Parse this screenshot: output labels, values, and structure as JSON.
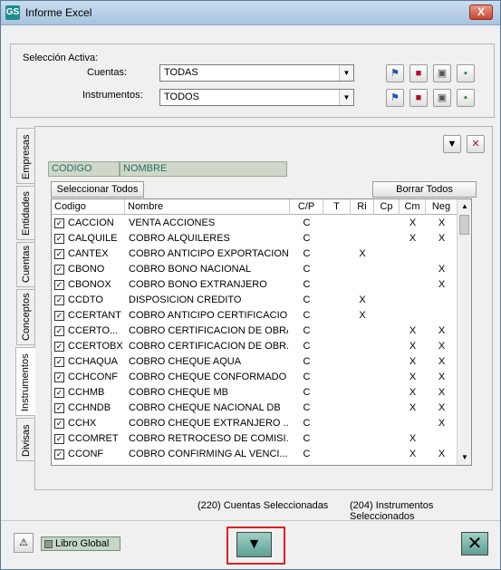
{
  "window": {
    "title": "Informe Excel",
    "app_icon": "GS",
    "close": "X"
  },
  "seleccion": {
    "title": "Selección Activa:",
    "cuentas_label": "Cuentas:",
    "cuentas_value": "TODAS",
    "instrumentos_label": "Instrumentos:",
    "instrumentos_value": "TODOS"
  },
  "tabs": [
    "Empresas",
    "Entidades",
    "Cuentas",
    "Conceptos",
    "Instrumentos",
    "Divisas"
  ],
  "active_tab": "Instrumentos",
  "filter_headers": {
    "codigo": "CODIGO",
    "nombre": "NOMBRE"
  },
  "buttons": {
    "select_all": "Seleccionar Todos",
    "clear_all": "Borrar Todos"
  },
  "columns": [
    "Codigo",
    "Nombre",
    "C/P",
    "T",
    "Ri",
    "Cp",
    "Cm",
    "Neg"
  ],
  "rows": [
    {
      "codigo": "CACCION",
      "nombre": "VENTA ACCIONES",
      "cp": "C",
      "t": "",
      "ri": "",
      "cpx": "",
      "cm": "X",
      "neg": "X"
    },
    {
      "codigo": "CALQUILE",
      "nombre": "COBRO ALQUILERES",
      "cp": "C",
      "t": "",
      "ri": "",
      "cpx": "",
      "cm": "X",
      "neg": "X"
    },
    {
      "codigo": "CANTEX",
      "nombre": "COBRO ANTICIPO EXPORTACION",
      "cp": "C",
      "t": "",
      "ri": "X",
      "cpx": "",
      "cm": "",
      "neg": ""
    },
    {
      "codigo": "CBONO",
      "nombre": "COBRO BONO NACIONAL",
      "cp": "C",
      "t": "",
      "ri": "",
      "cpx": "",
      "cm": "",
      "neg": "X"
    },
    {
      "codigo": "CBONOX",
      "nombre": "COBRO BONO EXTRANJERO",
      "cp": "C",
      "t": "",
      "ri": "",
      "cpx": "",
      "cm": "",
      "neg": "X"
    },
    {
      "codigo": "CCDTO",
      "nombre": "DISPOSICION CREDITO",
      "cp": "C",
      "t": "",
      "ri": "X",
      "cpx": "",
      "cm": "",
      "neg": ""
    },
    {
      "codigo": "CCERTANT",
      "nombre": "COBRO ANTICIPO CERTIFICACION",
      "cp": "C",
      "t": "",
      "ri": "X",
      "cpx": "",
      "cm": "",
      "neg": ""
    },
    {
      "codigo": "CCERTO...",
      "nombre": "COBRO CERTIFICACION DE OBRA",
      "cp": "C",
      "t": "",
      "ri": "",
      "cpx": "",
      "cm": "X",
      "neg": "X"
    },
    {
      "codigo": "CCERTOBX",
      "nombre": "COBRO CERTIFICACION DE OBR...",
      "cp": "C",
      "t": "",
      "ri": "",
      "cpx": "",
      "cm": "X",
      "neg": "X"
    },
    {
      "codigo": "CCHAQUA",
      "nombre": "COBRO CHEQUE AQUA",
      "cp": "C",
      "t": "",
      "ri": "",
      "cpx": "",
      "cm": "X",
      "neg": "X"
    },
    {
      "codigo": "CCHCONF",
      "nombre": "COBRO CHEQUE CONFORMADO",
      "cp": "C",
      "t": "",
      "ri": "",
      "cpx": "",
      "cm": "X",
      "neg": "X"
    },
    {
      "codigo": "CCHMB",
      "nombre": "COBRO CHEQUE MB",
      "cp": "C",
      "t": "",
      "ri": "",
      "cpx": "",
      "cm": "X",
      "neg": "X"
    },
    {
      "codigo": "CCHNDB",
      "nombre": "COBRO CHEQUE NACIONAL DB",
      "cp": "C",
      "t": "",
      "ri": "",
      "cpx": "",
      "cm": "X",
      "neg": "X"
    },
    {
      "codigo": "CCHX",
      "nombre": "COBRO CHEQUE EXTRANJERO ...",
      "cp": "C",
      "t": "",
      "ri": "",
      "cpx": "",
      "cm": "",
      "neg": "X"
    },
    {
      "codigo": "CCOMRET",
      "nombre": "COBRO RETROCESO DE COMISI...",
      "cp": "C",
      "t": "",
      "ri": "",
      "cpx": "",
      "cm": "X",
      "neg": ""
    },
    {
      "codigo": "CCONF",
      "nombre": "COBRO CONFIRMING AL VENCI...",
      "cp": "C",
      "t": "",
      "ri": "",
      "cpx": "",
      "cm": "X",
      "neg": "X"
    }
  ],
  "status": {
    "cuentas": "(220) Cuentas Seleccionadas",
    "instrumentos": "(204) Instrumentos Seleccionados"
  },
  "footer": {
    "libro": "Libro Global",
    "warn_icon": "⚠",
    "down_icon": "▼",
    "cancel_icon": "✕"
  },
  "icons": [
    "flag-icon",
    "save-icon",
    "trash-icon",
    "excel-icon",
    "filter-icon",
    "clear-filter-icon"
  ]
}
